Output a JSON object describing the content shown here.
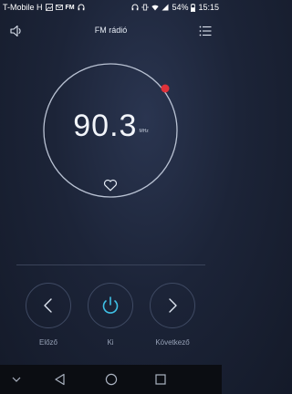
{
  "status_bar": {
    "carrier": "T-Mobile H",
    "battery": "54%",
    "time": "15:15",
    "fm_badge": "FM"
  },
  "app": {
    "title": "FM rádió"
  },
  "tuner": {
    "frequency": "90.3",
    "unit": "MHz",
    "indicator_color": "#e0323a"
  },
  "controls": {
    "prev_label": "Előző",
    "power_label": "Ki",
    "next_label": "Következő",
    "power_color": "#3fc1e6"
  },
  "icons": [
    "volume-icon",
    "menu-icon",
    "heart-icon",
    "chevron-left-icon",
    "power-icon",
    "chevron-right-icon",
    "back-icon",
    "home-icon",
    "recents-icon",
    "nav-hide-icon"
  ]
}
